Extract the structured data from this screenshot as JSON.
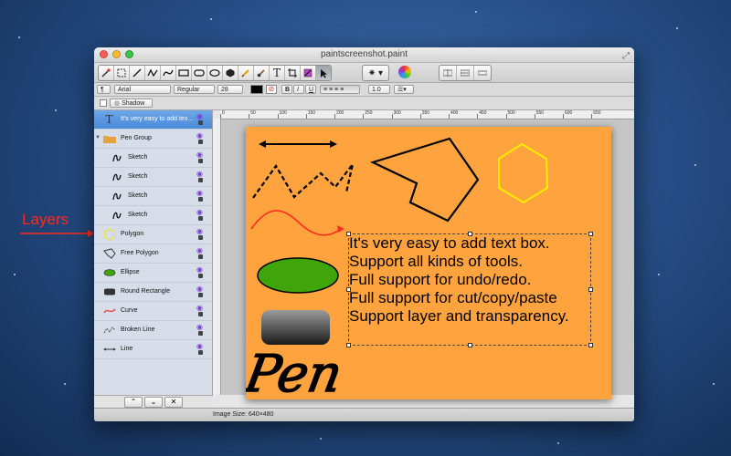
{
  "window": {
    "title": "paintscreenshot.paint",
    "icons": [
      "close-light",
      "minimize-light",
      "zoom-light",
      "fullscreen-icon"
    ]
  },
  "toolbar": {
    "tools": [
      "eyedropper",
      "selection",
      "line",
      "broken-line",
      "curve",
      "rectangle",
      "rounded-rectangle",
      "ellipse",
      "polygon",
      "pencil",
      "brush",
      "text",
      "crop",
      "zoom",
      "pointer"
    ],
    "active_tool": "pointer",
    "gear_label": "✷",
    "right_buttons": [
      "align-left",
      "align-center",
      "align-right"
    ]
  },
  "format_bar": {
    "font_family": "Arial",
    "font_style": "Regular",
    "font_size": "28",
    "bold_label": "B",
    "italic_label": "I",
    "underline_label": "U",
    "line_spacing": "1.0"
  },
  "shadow_bar": {
    "shadow_label": "Shadow"
  },
  "layers": [
    {
      "label": "It's very easy to add tex...",
      "icon": "text-icon",
      "selected": true,
      "indent": false
    },
    {
      "label": "Pen Group",
      "icon": "folder-icon",
      "selected": false,
      "indent": false
    },
    {
      "label": "Sketch",
      "icon": "sketch-icon",
      "selected": false,
      "indent": true
    },
    {
      "label": "Sketch",
      "icon": "sketch-icon",
      "selected": false,
      "indent": true
    },
    {
      "label": "Sketch",
      "icon": "sketch-icon",
      "selected": false,
      "indent": true
    },
    {
      "label": "Sketch",
      "icon": "sketch-icon",
      "selected": false,
      "indent": true
    },
    {
      "label": "Polygon",
      "icon": "polygon-icon",
      "selected": false,
      "indent": false
    },
    {
      "label": "Free Polygon",
      "icon": "free-polygon-icon",
      "selected": false,
      "indent": false
    },
    {
      "label": "Ellipse",
      "icon": "ellipse-icon",
      "selected": false,
      "indent": false
    },
    {
      "label": "Round Rectangle",
      "icon": "round-rectangle-icon",
      "selected": false,
      "indent": false
    },
    {
      "label": "Curve",
      "icon": "curve-icon",
      "selected": false,
      "indent": false
    },
    {
      "label": "Broken Line",
      "icon": "broken-line-icon",
      "selected": false,
      "indent": false
    },
    {
      "label": "Line",
      "icon": "line-icon",
      "selected": false,
      "indent": false
    }
  ],
  "panel_buttons": {
    "up": "⌃",
    "down": "⌄",
    "delete": "✕"
  },
  "ruler": {
    "ticks": [
      "0",
      "50",
      "100",
      "150",
      "200",
      "250",
      "300",
      "350",
      "400",
      "450",
      "500",
      "550",
      "600",
      "650"
    ]
  },
  "canvas": {
    "background": "#ffa33f",
    "text_lines": [
      "It's very easy to add text box.",
      "Support all kinds of tools.",
      "Full support for undo/redo.",
      "Full support for cut/copy/paste",
      "Support layer and transparency."
    ],
    "pen_text": "Pen",
    "colors": {
      "ellipse": "#3fa50a",
      "hexagon": "#ffee00",
      "curve": "#ff2a1f"
    }
  },
  "status": {
    "image_size": "Image Size: 640×480"
  },
  "annotation": {
    "label": "Layers",
    "color": "#ff2a1f"
  }
}
